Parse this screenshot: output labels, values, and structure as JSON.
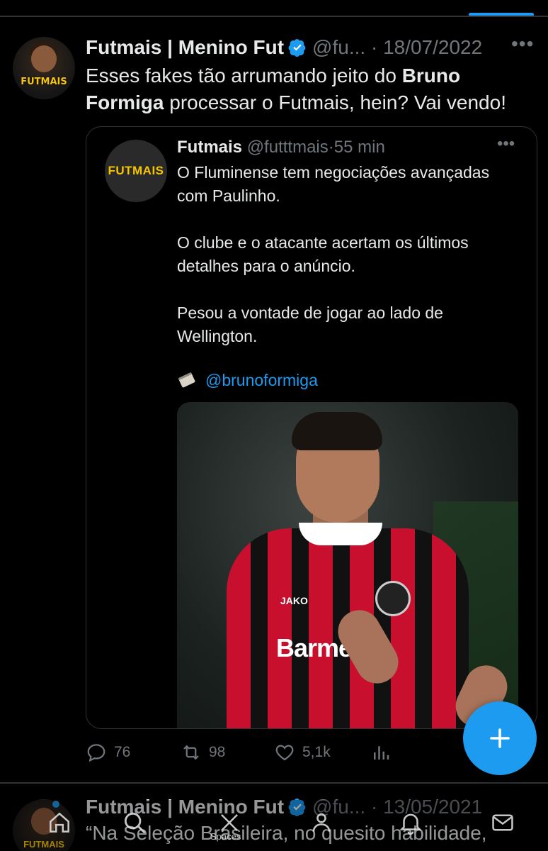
{
  "tweet": {
    "display_name": "Futmais | Menino Fut",
    "handle": "@fu...",
    "separator": "·",
    "date": "18/07/2022",
    "more": "•••",
    "avatar_logo": "FUTMAIS",
    "text_parts": {
      "before_bold": "Esses fakes tão arrumando jeito do ",
      "bold": "Bruno Formiga",
      "after_bold": " processar o Futmais, hein? Vai vendo!"
    },
    "actions": {
      "replies": "76",
      "retweets": "98",
      "likes": "5,1k"
    }
  },
  "quoted_tweet": {
    "avatar_logo": "FUTMAIS",
    "display_name": "Futmais",
    "handle": "@futttmais",
    "separator": "·",
    "time": "55 min",
    "more": "•••",
    "paragraphs": [
      "O Fluminense tem negociações avançadas com Paulinho.",
      "O clube e o atacante acertam os últimos detalhes para o anúncio.",
      "Pesou a vontade de jogar ao lado de Wellington."
    ],
    "mention": "@brunoformiga",
    "photo": {
      "kit_brand": "JAKO",
      "sponsor": "Barmenia"
    }
  },
  "next_tweet": {
    "display_name": "Futmais | Menino Fut",
    "handle": "@fu...",
    "separator": "·",
    "date": "13/05/2021",
    "avatar_logo": "FUTMAIS",
    "text": "“Na Seleção Brasileira, no quesito habilidade,"
  },
  "tabbar": {
    "spaces_label": "Spaces"
  },
  "colors": {
    "background": "#000000",
    "text": "#e7e9ea",
    "muted": "#71767b",
    "accent": "#1d9bf0",
    "border": "#2f3336"
  },
  "icons": [
    "verified-badge-icon",
    "more-icon",
    "scroll-icon",
    "reply-icon",
    "retweet-icon",
    "like-icon",
    "analytics-icon",
    "share-icon",
    "compose-plus-icon",
    "home-icon",
    "search-icon",
    "spaces-icon",
    "communities-icon",
    "notifications-icon",
    "messages-icon"
  ]
}
